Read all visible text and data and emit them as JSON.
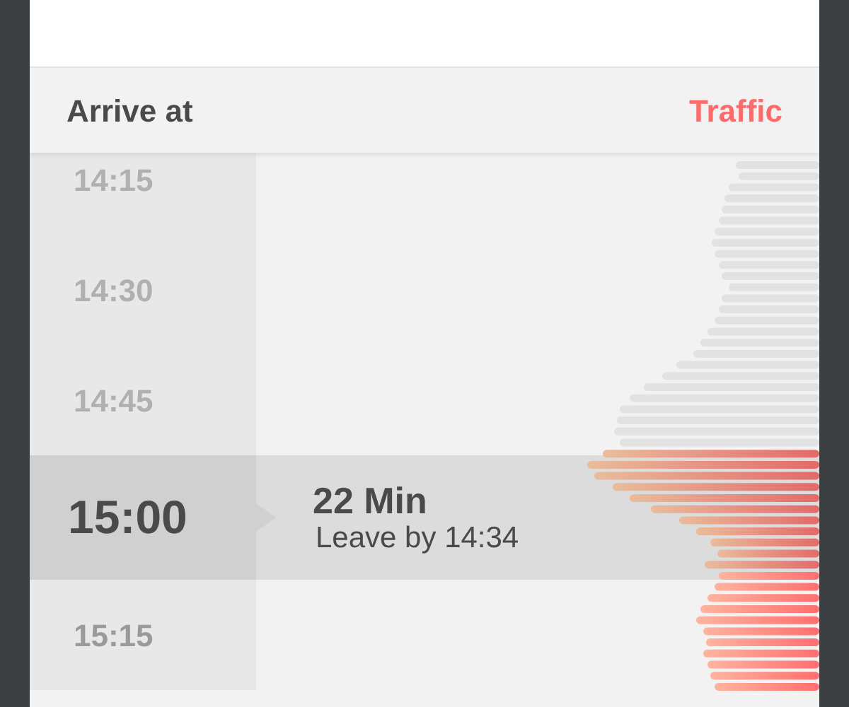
{
  "header": {
    "title": "Arrive at",
    "action": "Traffic"
  },
  "slots": [
    {
      "time": "14:15",
      "selected": false,
      "past": true
    },
    {
      "time": "14:30",
      "selected": false,
      "past": true
    },
    {
      "time": "14:45",
      "selected": false,
      "past": true
    },
    {
      "time": "15:00",
      "selected": true,
      "past": false,
      "duration": "22 Min",
      "leave": "Leave by 14:34"
    },
    {
      "time": "15:15",
      "selected": false,
      "past": false
    }
  ]
}
